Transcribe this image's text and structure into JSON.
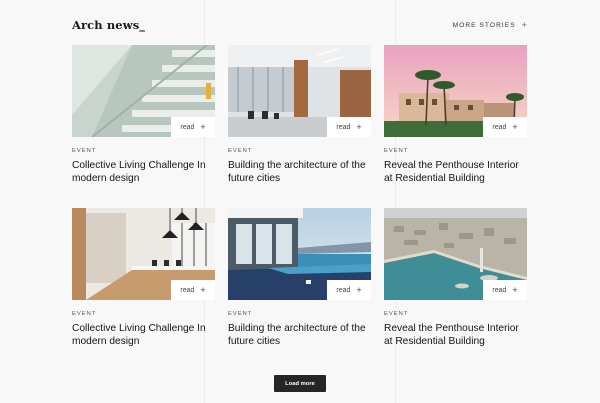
{
  "header": {
    "title": "Arch news_",
    "more_label": "MORE STORIES",
    "more_icon": "plus-icon"
  },
  "cards": [
    {
      "image": "white-staircase-photo",
      "read_label": "read",
      "tag": "EVENT",
      "title": "Collective Living Challenge In modern design"
    },
    {
      "image": "office-corridor-photo",
      "read_label": "read",
      "tag": "EVENT",
      "title": "Building the architecture of the future cities"
    },
    {
      "image": "palm-tree-villas-photo",
      "read_label": "read",
      "tag": "EVENT",
      "title": "Reveal the Penthouse Interior at Residential Building"
    },
    {
      "image": "open-office-interior-photo",
      "read_label": "read",
      "tag": "EVENT",
      "title": "Collective Living Challenge In modern design"
    },
    {
      "image": "infinity-pool-villa-photo",
      "read_label": "read",
      "tag": "EVENT",
      "title": "Building the architecture of the future cities"
    },
    {
      "image": "coastal-city-aerial-photo",
      "read_label": "read",
      "tag": "EVENT",
      "title": "Reveal the Penthouse Interior at Residential Building"
    }
  ],
  "load_more_label": "Load more",
  "colors": {
    "background": "#f8f8f8",
    "button": "#262626"
  }
}
